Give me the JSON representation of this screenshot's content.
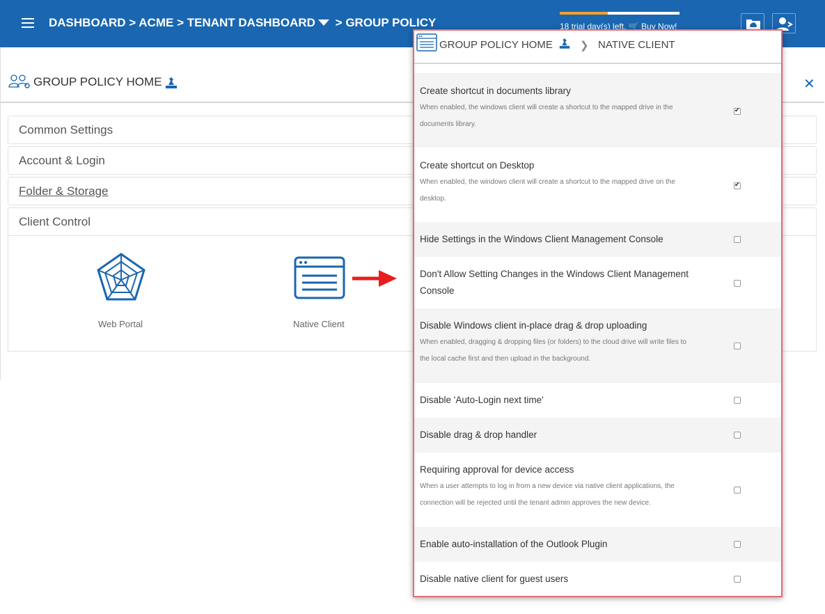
{
  "topbar": {
    "crumb_dashboard": "DASHBOARD",
    "crumb_acme": "ACME",
    "crumb_tenant": "TENANT DASHBOARD",
    "crumb_group": "GROUP POLICY",
    "sep": ">",
    "trial_text": "18 trial day(s) left.",
    "buy_now": "Buy Now!",
    "trial_progress": 0.4
  },
  "page": {
    "title": "GROUP POLICY HOME",
    "close": "✕"
  },
  "accordion": [
    {
      "label": "Common Settings"
    },
    {
      "label": "Account & Login"
    },
    {
      "label": "Folder & Storage"
    },
    {
      "label": "Client Control"
    }
  ],
  "tiles": {
    "web_portal": "Web Portal",
    "native_client": "Native Client"
  },
  "popup": {
    "title": "GROUP POLICY HOME",
    "current": "NATIVE CLIENT",
    "settings": [
      {
        "title": "Create shortcut in documents library",
        "desc": "When enabled, the windows client will create a shortcut to the mapped drive in the",
        "desc2": "documents library.",
        "checked": true
      },
      {
        "title": "Create shortcut on Desktop",
        "desc": "When enabled, the windows client will create a shortcut to the mapped drive on the",
        "desc2": "desktop.",
        "checked": true
      },
      {
        "title": "Hide Settings in the Windows Client Management Console",
        "checked": false
      },
      {
        "title": "Don't Allow Setting Changes in the Windows Client Management",
        "title2": "Console",
        "checked": false
      },
      {
        "title": "Disable Windows client in-place drag & drop uploading",
        "desc": "When enabled, dragging & dropping files (or folders) to the cloud drive will write files to",
        "desc2": "the local cache first and then upload in the background.",
        "checked": false
      },
      {
        "title": "Disable 'Auto-Login next time'",
        "checked": false
      },
      {
        "title": "Disable drag & drop handler",
        "checked": false
      },
      {
        "title": "Requiring approval for device access",
        "desc": "When a user attempts to log in from a new device via native client applications, the",
        "desc2": "connection will be rejected until the tenant admin approves the new device.",
        "checked": false
      },
      {
        "title": "Enable auto-installation of the Outlook Plugin",
        "checked": false
      },
      {
        "title": "Disable native client for guest users",
        "checked": false
      }
    ]
  },
  "colors": {
    "brand": "#1a66b0",
    "trial_fill": "#f0a030",
    "highlight_border": "#e46a74",
    "arrow": "#e81e1e"
  }
}
